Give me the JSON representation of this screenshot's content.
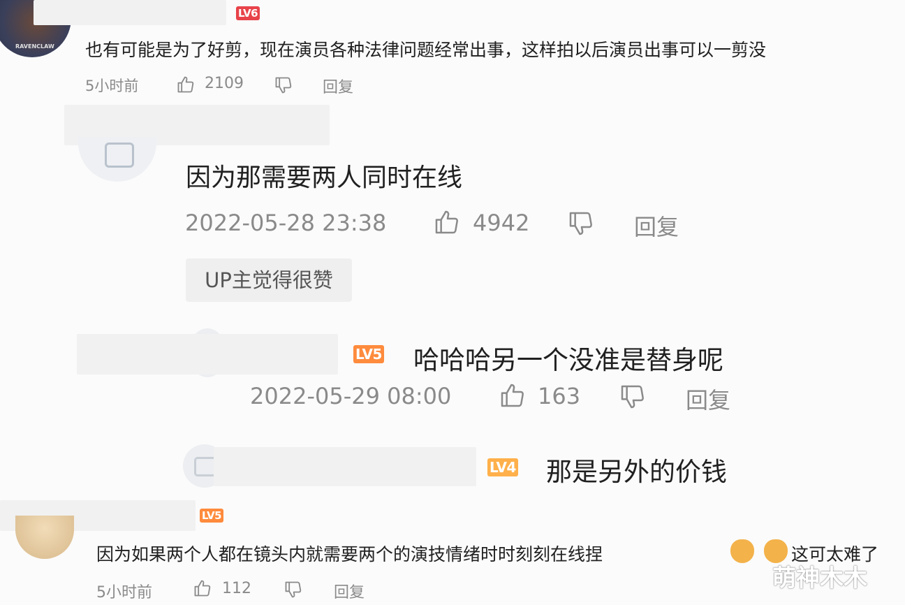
{
  "comments": [
    {
      "level": "LV6",
      "text": "也有可能是为了好剪，现在演员各种法律问题经常出事，这样拍以后演员出事可以一剪没",
      "time": "5小时前",
      "likes": "2109",
      "reply": "回复",
      "avatar_text": "RAVENCLAW"
    },
    {
      "text": "因为那需要两人同时在线",
      "time": "2022-05-28 23:38",
      "likes": "4942",
      "reply": "回复",
      "tag": "UP主觉得很赞"
    },
    {
      "level": "LV5",
      "text": "哈哈哈另一个没准是替身呢",
      "time": "2022-05-29 08:00",
      "likes": "163",
      "reply": "回复"
    },
    {
      "level": "LV4",
      "text": "那是另外的价钱"
    },
    {
      "level": "LV5",
      "text": "因为如果两个人都在镜头内就需要两个的演技情绪时时刻刻在线捏",
      "text_tail": "这可太难了",
      "time": "5小时前",
      "likes": "112",
      "reply": "回复"
    }
  ],
  "watermark": "萌神木木",
  "colors": {
    "lv6": "#e8434a",
    "lv5": "#ff8b3d",
    "lv4": "#ffb04a"
  }
}
